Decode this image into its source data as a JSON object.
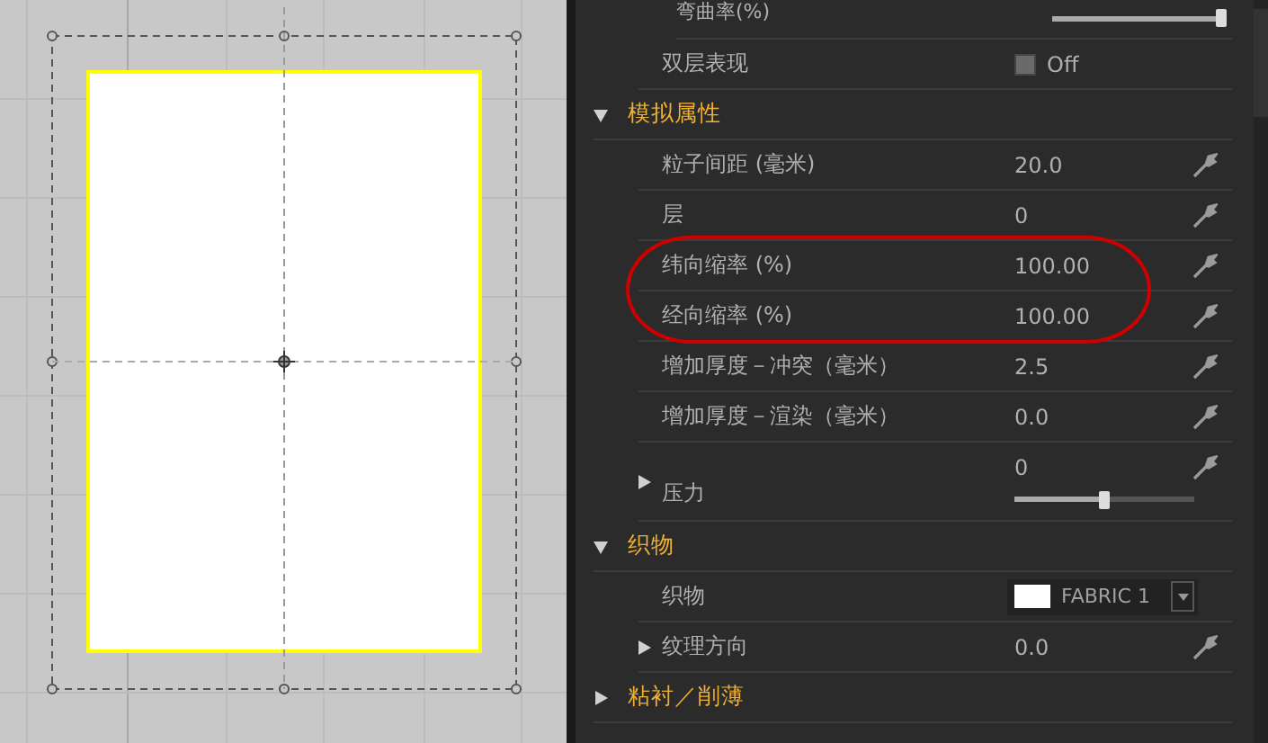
{
  "property_sections": [
    {
      "rows": [
        {
          "kind": "slider",
          "label": "弯曲率(%)",
          "level": 0.98
        },
        {
          "kind": "toggle",
          "label": "双层表现",
          "checked": false,
          "value": "Off"
        }
      ]
    },
    {
      "title": "模拟属性",
      "expanded": true,
      "rows": [
        {
          "kind": "value",
          "label": "粒子间距 (毫米)",
          "value": "20.0"
        },
        {
          "kind": "value",
          "label": "层",
          "value": "0"
        },
        {
          "kind": "value",
          "label": "纬向缩率 (%)",
          "value": "100.00"
        },
        {
          "kind": "value",
          "label": "经向缩率 (%)",
          "value": "100.00"
        },
        {
          "kind": "value",
          "label": "增加厚度－冲突（毫米）",
          "value": "2.5"
        },
        {
          "kind": "value",
          "label": "增加厚度－渲染（毫米）",
          "value": "0.0"
        },
        {
          "kind": "value_slider",
          "label": "压力",
          "value": "0",
          "level": 0.5,
          "expanded": false
        }
      ]
    },
    {
      "title": "织物",
      "expanded": true,
      "rows": [
        {
          "kind": "fabric",
          "label": "织物",
          "value": "FABRIC 1"
        },
        {
          "kind": "value",
          "label": "纹理方向",
          "value": "0.0",
          "expanded": false
        }
      ]
    },
    {
      "title": "粘衬／削薄",
      "expanded": false
    }
  ]
}
